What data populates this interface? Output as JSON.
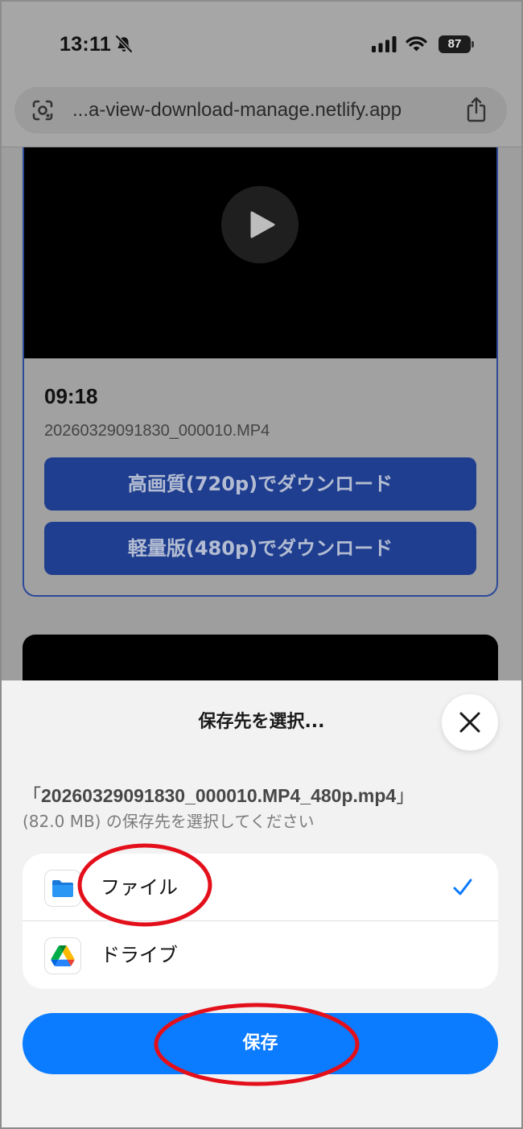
{
  "status_bar": {
    "time": "13:11",
    "battery": "87",
    "icons": [
      "bell-slash-icon",
      "cellular-signal-icon",
      "wifi-icon",
      "battery-icon"
    ]
  },
  "browser": {
    "url": "...a-view-download-manage.netlify.app",
    "icons": [
      "lens-icon",
      "share-icon"
    ]
  },
  "video_card": {
    "duration": "09:18",
    "filename": "20260329091830_000010.MP4",
    "buttons": {
      "hq": "高画質(720p)でダウンロード",
      "light": "軽量版(480p)でダウンロード"
    },
    "icons": [
      "play-icon"
    ]
  },
  "save_sheet": {
    "title": "保存先を選択...",
    "file_quote_open": "「",
    "file_name": "20260329091830_000010.MP4_480p.mp4",
    "file_quote_close": "」",
    "description": "(82.0 MB) の保存先を選択してください",
    "destinations": [
      {
        "label": "ファイル",
        "icon": "folder-icon",
        "selected": true
      },
      {
        "label": "ドライブ",
        "icon": "google-drive-icon",
        "selected": false
      }
    ],
    "save_label": "保存",
    "icons": [
      "close-icon",
      "checkmark-icon"
    ]
  },
  "colors": {
    "accent": "#0B7BFF",
    "download_button": "#1F3E8F",
    "card_border": "#2C4A9A",
    "sheet_background": "#F2F2F2",
    "annotation": "#E3101B"
  }
}
